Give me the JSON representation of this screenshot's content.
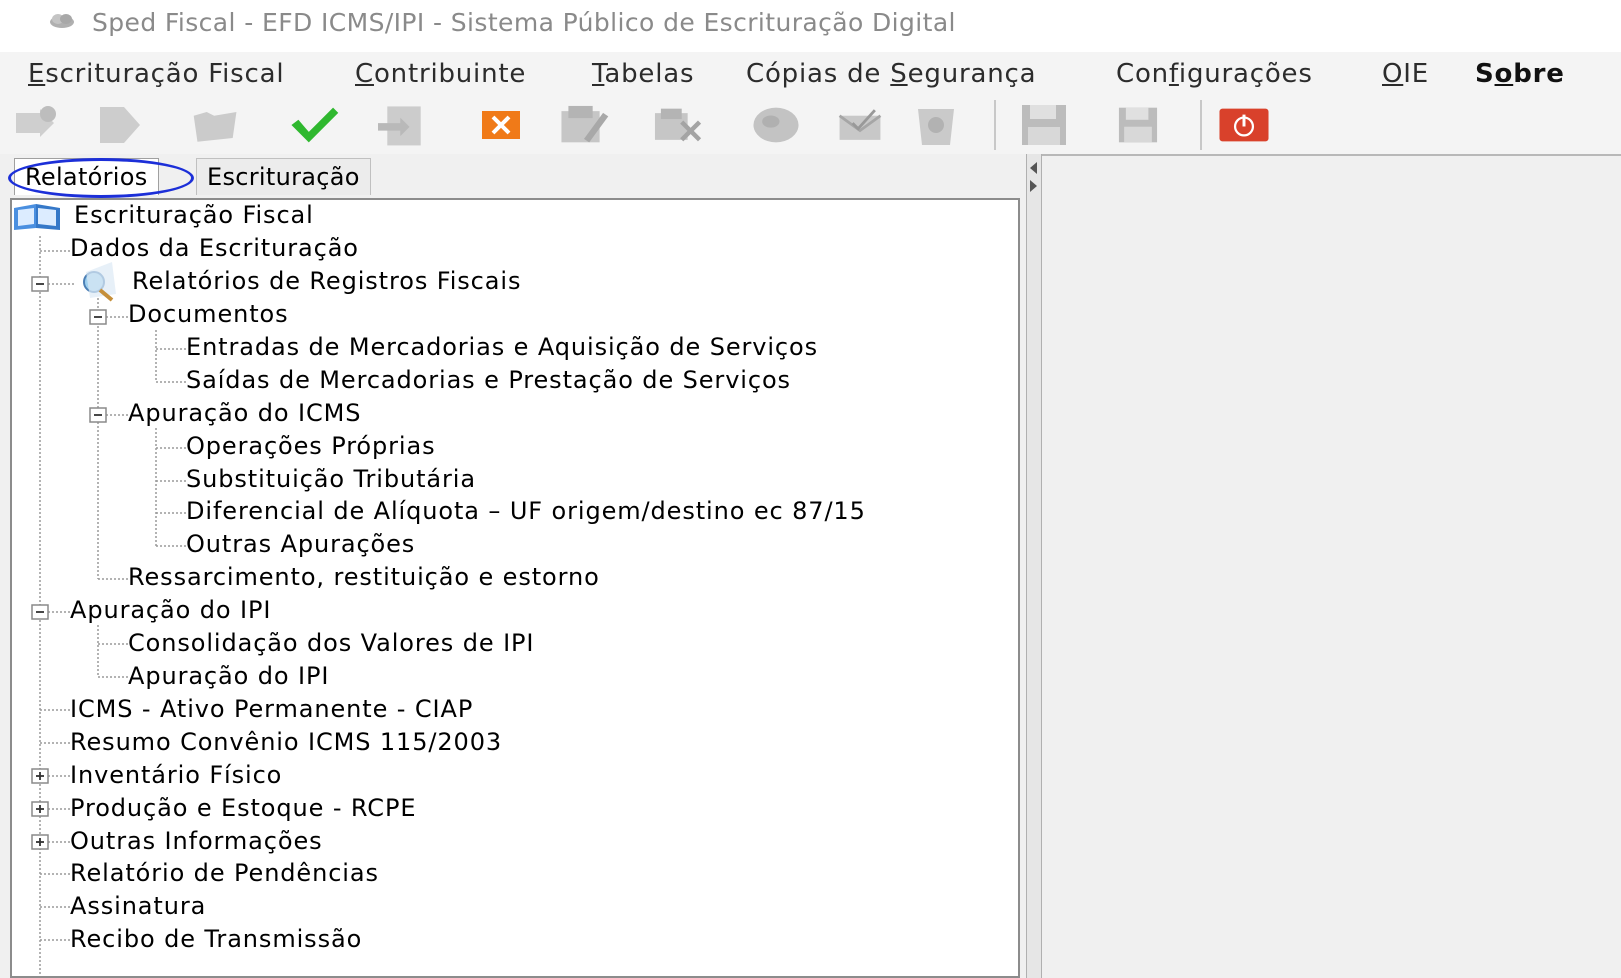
{
  "window": {
    "title": "Sped Fiscal - EFD ICMS/IPI - Sistema Público de Escrituração Digital",
    "app_icon": "cloud-icon"
  },
  "menubar": {
    "items": [
      {
        "label": "Escrituração Fiscal",
        "mnemonic": "E"
      },
      {
        "label": "Contribuinte",
        "mnemonic": "C"
      },
      {
        "label": "Tabelas",
        "mnemonic": "T"
      },
      {
        "label": "Cópias de Segurança",
        "mnemonic": "S"
      },
      {
        "label": "Configurações",
        "mnemonic": "f"
      },
      {
        "label": "OIE",
        "mnemonic": "O"
      },
      {
        "label": "Sobre",
        "mnemonic": "o"
      }
    ]
  },
  "toolbar": {
    "buttons": [
      {
        "icon": "new-document-icon",
        "enabled": false
      },
      {
        "icon": "forward-arrow-icon",
        "enabled": false
      },
      {
        "icon": "open-folder-icon",
        "enabled": false
      },
      {
        "icon": "validate-check-icon",
        "enabled": true
      },
      {
        "icon": "import-document-icon",
        "enabled": false
      },
      {
        "icon": "close-file-icon",
        "enabled": true
      },
      {
        "icon": "edit-register-icon",
        "enabled": false
      },
      {
        "icon": "delete-register-icon",
        "enabled": false
      },
      {
        "icon": "globe-icon",
        "enabled": false
      },
      {
        "icon": "sign-envelope-icon",
        "enabled": false
      },
      {
        "icon": "trash-icon",
        "enabled": false
      },
      {
        "icon": "save-icon",
        "enabled": false
      },
      {
        "icon": "save-as-icon",
        "enabled": false
      },
      {
        "icon": "power-icon",
        "enabled": true
      }
    ]
  },
  "tabs": [
    {
      "label": "Relatórios",
      "active": true
    },
    {
      "label": "Escrituração",
      "active": false
    }
  ],
  "tree": {
    "root": "Escrituração Fiscal",
    "nodes": [
      {
        "label": "Dados da Escrituração",
        "level": 1
      },
      {
        "label": "Relatórios de Registros Fiscais",
        "level": 1,
        "expanded": true
      },
      {
        "label": "Documentos",
        "level": 2,
        "expanded": true
      },
      {
        "label": "Entradas de Mercadorias e Aquisição de Serviços",
        "level": 3
      },
      {
        "label": "Saídas de Mercadorias e Prestação de Serviços",
        "level": 3
      },
      {
        "label": "Apuração do ICMS",
        "level": 2,
        "expanded": true
      },
      {
        "label": "Operações Próprias",
        "level": 3
      },
      {
        "label": "Substituição Tributária",
        "level": 3
      },
      {
        "label": "Diferencial de Alíquota – UF origem/destino ec 87/15",
        "level": 3
      },
      {
        "label": "Outras Apurações",
        "level": 3
      },
      {
        "label": "Ressarcimento, restituição e estorno",
        "level": 2
      },
      {
        "label": "Apuração do IPI",
        "level": 1,
        "expanded": true
      },
      {
        "label": "Consolidação dos Valores de IPI",
        "level": 2
      },
      {
        "label": "Apuração do IPI",
        "level": 2
      },
      {
        "label": "ICMS - Ativo Permanente - CIAP",
        "level": 1
      },
      {
        "label": "Resumo  Convênio ICMS 115/2003",
        "level": 1
      },
      {
        "label": "Inventário Físico",
        "level": 1,
        "expanded": false
      },
      {
        "label": "Produção e Estoque - RCPE",
        "level": 1,
        "expanded": false
      },
      {
        "label": "Outras Informações",
        "level": 1,
        "expanded": false
      },
      {
        "label": "Relatório de Pendências",
        "level": 1
      },
      {
        "label": "Assinatura",
        "level": 1
      },
      {
        "label": "Recibo de Transmissão",
        "level": 1
      }
    ]
  },
  "colors": {
    "highlight_ring": "#1c2fd8",
    "check_green": "#2fb82f",
    "close_orange": "#f07a18",
    "power_red": "#d9412b"
  }
}
